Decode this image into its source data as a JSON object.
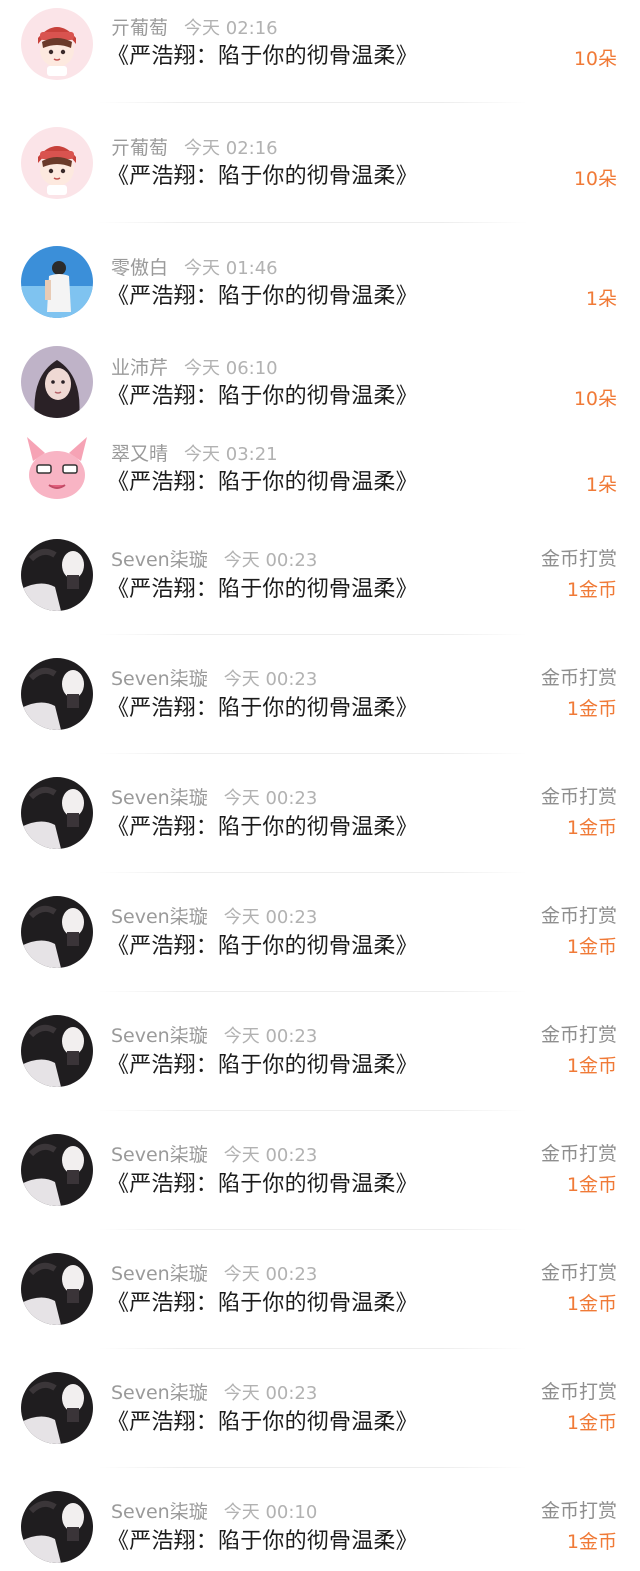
{
  "book_title": "《严浩翔：陷于你的彻骨温柔》",
  "flower_records": [
    {
      "username": "亓葡萄",
      "time": "今天 02:16",
      "amount": "10朵",
      "avatar": "cartoon-girl-avatar"
    },
    {
      "username": "亓葡萄",
      "time": "今天 02:16",
      "amount": "10朵",
      "avatar": "cartoon-girl-avatar"
    },
    {
      "username": "零傲白",
      "time": "今天 01:46",
      "amount": "1朵",
      "avatar": "photo-person-avatar"
    },
    {
      "username": "业沛芹",
      "time": "今天 06:10",
      "amount": "10朵",
      "avatar": "portrait-avatar"
    },
    {
      "username": "翠又晴",
      "time": "今天 03:21",
      "amount": "1朵",
      "avatar": "pink-bunny-avatar"
    }
  ],
  "coin_records": [
    {
      "username": "Seven柒璇",
      "time": "今天 00:23",
      "gift_type": "金币打赏",
      "amount": "1金币",
      "avatar": "dark-photo-avatar"
    },
    {
      "username": "Seven柒璇",
      "time": "今天 00:23",
      "gift_type": "金币打赏",
      "amount": "1金币",
      "avatar": "dark-photo-avatar"
    },
    {
      "username": "Seven柒璇",
      "time": "今天 00:23",
      "gift_type": "金币打赏",
      "amount": "1金币",
      "avatar": "dark-photo-avatar"
    },
    {
      "username": "Seven柒璇",
      "time": "今天 00:23",
      "gift_type": "金币打赏",
      "amount": "1金币",
      "avatar": "dark-photo-avatar"
    },
    {
      "username": "Seven柒璇",
      "time": "今天 00:23",
      "gift_type": "金币打赏",
      "amount": "1金币",
      "avatar": "dark-photo-avatar"
    },
    {
      "username": "Seven柒璇",
      "time": "今天 00:23",
      "gift_type": "金币打赏",
      "amount": "1金币",
      "avatar": "dark-photo-avatar"
    },
    {
      "username": "Seven柒璇",
      "time": "今天 00:23",
      "gift_type": "金币打赏",
      "amount": "1金币",
      "avatar": "dark-photo-avatar"
    },
    {
      "username": "Seven柒璇",
      "time": "今天 00:23",
      "gift_type": "金币打赏",
      "amount": "1金币",
      "avatar": "dark-photo-avatar"
    },
    {
      "username": "Seven柒璇",
      "time": "今天 00:10",
      "gift_type": "金币打赏",
      "amount": "1金币",
      "avatar": "dark-photo-avatar"
    }
  ],
  "colors": {
    "accent": "#f07a37",
    "secondary_text": "#9a9a9a",
    "primary_text": "#1c1c1c"
  }
}
